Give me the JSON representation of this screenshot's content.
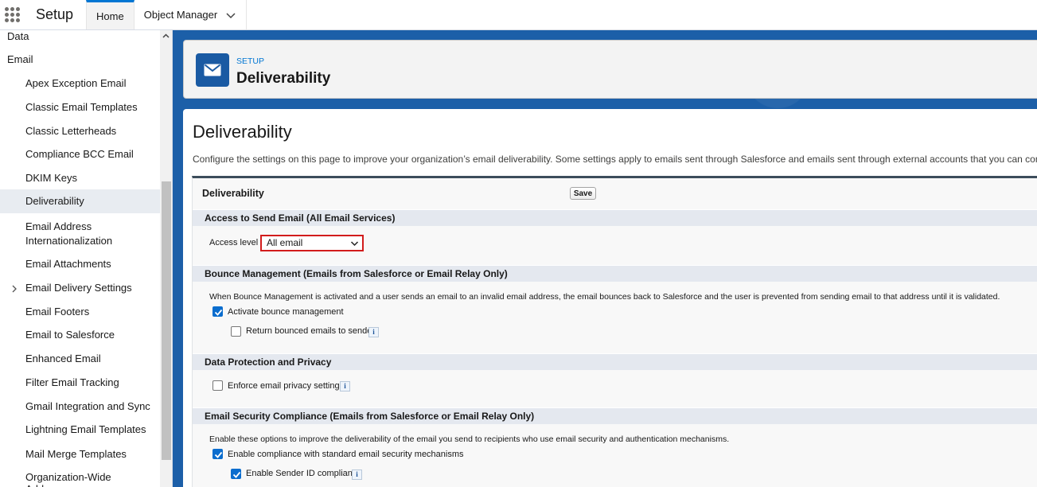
{
  "topbar": {
    "app_name": "Setup",
    "tabs": [
      {
        "label": "Home",
        "active": true
      },
      {
        "label": "Object Manager",
        "active": false
      }
    ]
  },
  "sidebar": {
    "items": [
      {
        "label": "Data",
        "level": "top"
      },
      {
        "label": "Email",
        "level": "top"
      },
      {
        "label": "Apex Exception Email",
        "level": "child"
      },
      {
        "label": "Classic Email Templates",
        "level": "child"
      },
      {
        "label": "Classic Letterheads",
        "level": "child"
      },
      {
        "label": "Compliance BCC Email",
        "level": "child"
      },
      {
        "label": "DKIM Keys",
        "level": "child"
      },
      {
        "label": "Deliverability",
        "level": "child",
        "selected": true
      },
      {
        "label": "Email Address",
        "label2": "Internationalization",
        "level": "child"
      },
      {
        "label": "Email Attachments",
        "level": "child"
      },
      {
        "label": "Email Delivery Settings",
        "level": "child",
        "expandable": true
      },
      {
        "label": "Email Footers",
        "level": "child"
      },
      {
        "label": "Email to Salesforce",
        "level": "child"
      },
      {
        "label": "Enhanced Email",
        "level": "child"
      },
      {
        "label": "Filter Email Tracking",
        "level": "child"
      },
      {
        "label": "Gmail Integration and Sync",
        "level": "child"
      },
      {
        "label": "Lightning Email Templates",
        "level": "child"
      },
      {
        "label": "Mail Merge Templates",
        "level": "child"
      },
      {
        "label": "Organization-Wide Addresses",
        "level": "child"
      }
    ]
  },
  "header": {
    "eyebrow": "SETUP",
    "title": "Deliverability",
    "icon": "envelope-icon"
  },
  "content": {
    "title": "Deliverability",
    "description": "Configure the settings on this page to improve your organization’s email deliverability. Some settings apply to emails sent through Salesforce and emails sent through external accounts that you can connect t"
  },
  "block": {
    "title": "Deliverability",
    "save_label": "Save",
    "access": {
      "heading": "Access to Send Email (All Email Services)",
      "label": "Access level",
      "selected": "All email"
    },
    "bounce": {
      "heading": "Bounce Management (Emails from Salesforce or Email Relay Only)",
      "description": "When Bounce Management is activated and a user sends an email to an invalid email address, the email bounces back to Salesforce and the user is prevented from sending email to that address until it is validated.",
      "activate_label": "Activate bounce management",
      "activate_checked": true,
      "return_label": "Return bounced emails to sender",
      "return_checked": false
    },
    "privacy": {
      "heading": "Data Protection and Privacy",
      "enforce_label": "Enforce email privacy settings",
      "enforce_checked": false
    },
    "security": {
      "heading": "Email Security Compliance (Emails from Salesforce or Email Relay Only)",
      "description": "Enable these options to improve the deliverability of the email you send to recipients who use email security and authentication mechanisms.",
      "compliance_label": "Enable compliance with standard email security mechanisms",
      "compliance_checked": true,
      "sender_label": "Enable Sender ID compliance",
      "sender_checked": true
    },
    "info_glyph": "i"
  },
  "colors": {
    "brand_blue": "#0176d3",
    "background_blue": "#1c5fa8",
    "highlight_red": "#d21c1c"
  }
}
